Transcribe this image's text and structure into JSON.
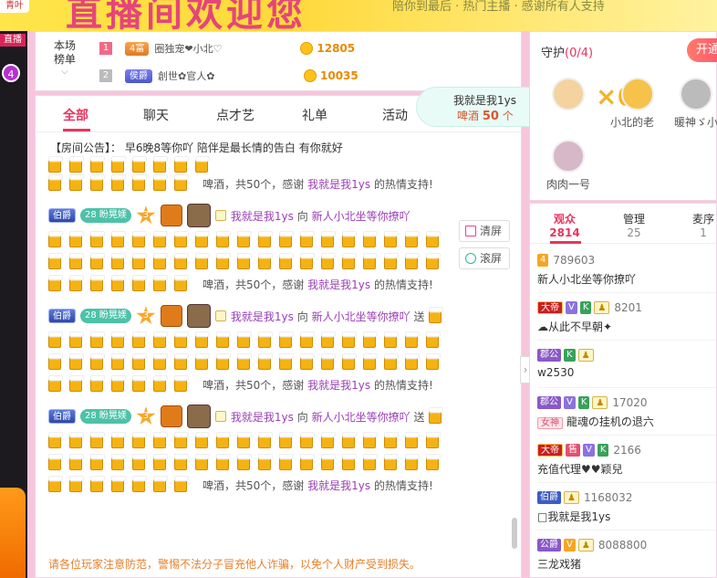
{
  "banner": {
    "tag": "青叶",
    "title": "直播间欢迎您",
    "subtitle": "陪你到最后 · 热门主播 · 感谢所有人支持"
  },
  "left": {
    "live": "直播",
    "count": "4"
  },
  "rank": {
    "label": "本场榜单",
    "rows": [
      {
        "num": "1",
        "badge": "4富",
        "name": "圈独宠❤小北♡",
        "score": "12805"
      },
      {
        "num": "2",
        "badge": "侯爵",
        "name": "創世✿官人✿",
        "score": "10035"
      }
    ]
  },
  "chat": {
    "tabs": [
      "全部",
      "聊天",
      "点才艺",
      "礼单",
      "活动"
    ],
    "notice": "【房间公告】：  早6晚8等你吖 陪伴是最长情的告白 有你就好",
    "thanks_pre": "啤酒，共50个，感谢",
    "thanks_name": "我就是我1ys",
    "thanks_post": "的热情支持!",
    "gift_badge": "伯爵",
    "gift_level": "28",
    "gift_level_name": "盼晃媄",
    "star_num": "3",
    "sender": "我就是我1ys",
    "verb": "向",
    "receiver": "新人小北坐等你撩吖",
    "send": "送",
    "clear_btn": "清屏",
    "roll_btn": "滚屏",
    "warning": "请各位玩家注意防范，警惕不法分子冒充他人诈骗，以免个人财产受到损失。"
  },
  "bubble": {
    "line1": "我就是我1ys",
    "gift": "啤酒",
    "count": "50",
    "unit": "个"
  },
  "guard": {
    "title": "守护",
    "count": "(0/4)",
    "open": "开通",
    "members": [
      {
        "name": "小北的老"
      },
      {
        "name": "暖神ゞ小"
      },
      {
        "name": "肉肉一号"
      }
    ]
  },
  "audience": {
    "tabs": [
      {
        "label": "观众",
        "count": "2814"
      },
      {
        "label": "管理",
        "count": "25"
      },
      {
        "label": "麦序",
        "count": "1"
      }
    ],
    "rows": [
      {
        "badges": [
          {
            "t": "4",
            "c": "gold"
          }
        ],
        "uid": "789603",
        "name": "新人小北坐等你撩吖"
      },
      {
        "badges": [
          {
            "t": "大帝",
            "c": "emp"
          },
          {
            "t": "V",
            "c": "v"
          },
          {
            "t": "K",
            "c": "k"
          },
          {
            "t": "♟",
            "c": "m"
          }
        ],
        "uid": "8201",
        "name": "☁从此不早朝✦"
      },
      {
        "badges": [
          {
            "t": "郡公",
            "c": "duke"
          },
          {
            "t": "K",
            "c": "k"
          },
          {
            "t": "♟",
            "c": "m"
          }
        ],
        "uid": "",
        "name": "w2530"
      },
      {
        "badges": [
          {
            "t": "郡公",
            "c": "duke"
          },
          {
            "t": "V",
            "c": "v"
          },
          {
            "t": "K",
            "c": "k"
          },
          {
            "t": "♟",
            "c": "m"
          }
        ],
        "uid": "17020",
        "name": "龍魂の挂机の退六",
        "god": "女神"
      },
      {
        "badges": [
          {
            "t": "大帝",
            "c": "emp"
          },
          {
            "t": "售",
            "c": "sell"
          },
          {
            "t": "V",
            "c": "v"
          },
          {
            "t": "K",
            "c": "k"
          }
        ],
        "uid": "2166",
        "name": "充值代理♥♥颖兒"
      },
      {
        "badges": [
          {
            "t": "伯爵",
            "c": "bo"
          },
          {
            "t": "♟",
            "c": "m"
          }
        ],
        "uid": "1168032",
        "name": "□我就是我1ys"
      },
      {
        "badges": [
          {
            "t": "公爵",
            "c": "duke"
          },
          {
            "t": "V",
            "c": "gold"
          },
          {
            "t": "♟",
            "c": "m"
          }
        ],
        "uid": "8088800",
        "name": "三龙戏猪"
      }
    ]
  }
}
